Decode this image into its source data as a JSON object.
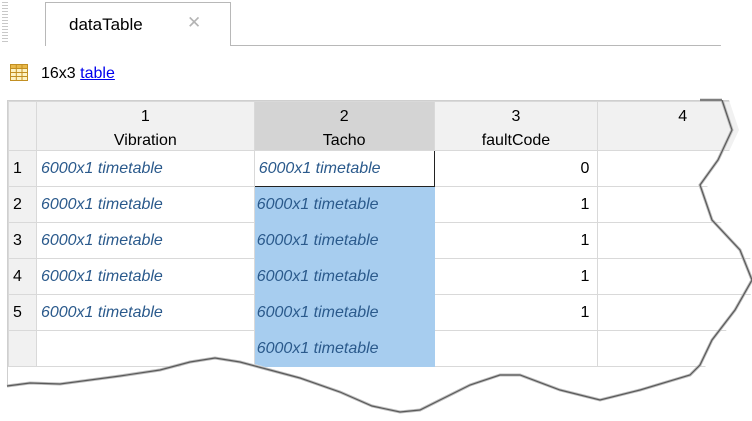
{
  "tab": {
    "title": "dataTable",
    "close_glyph": "✕"
  },
  "summary": {
    "size": "16x3",
    "type_link": "table"
  },
  "columns": [
    {
      "number": "1",
      "name": "Vibration"
    },
    {
      "number": "2",
      "name": "Tacho"
    },
    {
      "number": "3",
      "name": "faultCode"
    },
    {
      "number": "4",
      "name": ""
    }
  ],
  "rows": [
    {
      "index": "1",
      "vibration": "6000x1 timetable",
      "tacho": "6000x1 timetable",
      "faultCode": "0"
    },
    {
      "index": "2",
      "vibration": "6000x1 timetable",
      "tacho": "6000x1 timetable",
      "faultCode": "1"
    },
    {
      "index": "3",
      "vibration": "6000x1 timetable",
      "tacho": "6000x1 timetable",
      "faultCode": "1"
    },
    {
      "index": "4",
      "vibration": "6000x1 timetable",
      "tacho": "6000x1 timetable",
      "faultCode": "1"
    },
    {
      "index": "5",
      "vibration": "6000x1 timetable",
      "tacho": "6000x1 timetable",
      "faultCode": "1"
    },
    {
      "index": "",
      "vibration": "",
      "tacho": "6000x1 timetable",
      "faultCode": ""
    }
  ],
  "colors": {
    "selection": "#a7cdef",
    "selected_header": "#d4d4d4",
    "header_bg": "#f1f1f1",
    "timetable_text": "#2b5a8c",
    "link": "#0000ee"
  },
  "icons": {
    "variable_icon": "table-grid-icon",
    "tab_close_icon": "close-icon"
  }
}
